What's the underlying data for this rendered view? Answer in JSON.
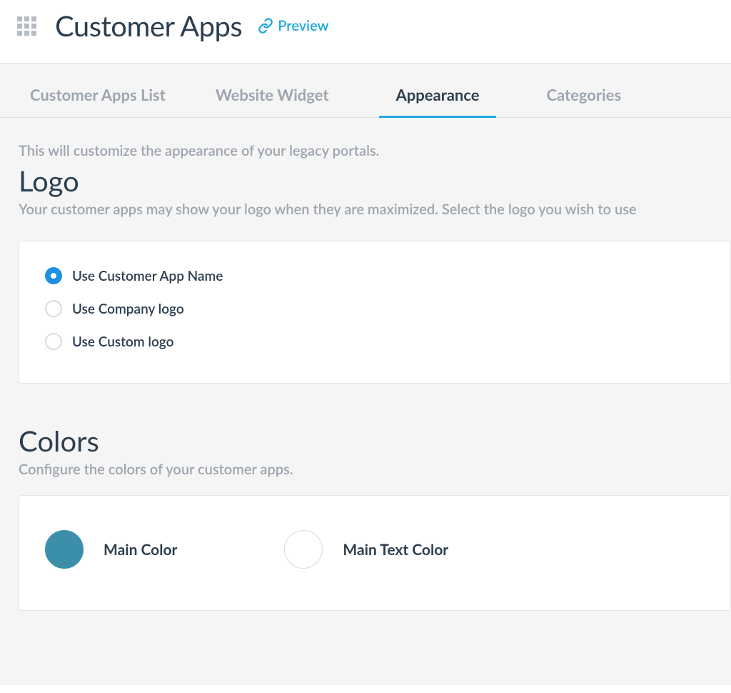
{
  "header": {
    "title": "Customer Apps",
    "preview_label": "Preview"
  },
  "tabs": [
    {
      "id": "list",
      "label": "Customer Apps List",
      "active": false
    },
    {
      "id": "widget",
      "label": "Website Widget",
      "active": false
    },
    {
      "id": "appearance",
      "label": "Appearance",
      "active": true
    },
    {
      "id": "categories",
      "label": "Categories",
      "active": false
    }
  ],
  "intro": "This will customize the appearance of your legacy portals.",
  "logo": {
    "heading": "Logo",
    "sub": "Your customer apps may show your logo when they are maximized. Select the logo you wish to use",
    "options": [
      {
        "id": "app-name",
        "label": "Use Customer App Name",
        "checked": true
      },
      {
        "id": "company-logo",
        "label": "Use Company logo",
        "checked": false
      },
      {
        "id": "custom-logo",
        "label": "Use Custom logo",
        "checked": false
      }
    ]
  },
  "colors": {
    "heading": "Colors",
    "sub": "Configure the colors of your customer apps.",
    "main_color": {
      "label": "Main Color",
      "hex": "#3c8fa9"
    },
    "main_text_color": {
      "label": "Main Text Color",
      "hex": "#ffffff"
    }
  }
}
